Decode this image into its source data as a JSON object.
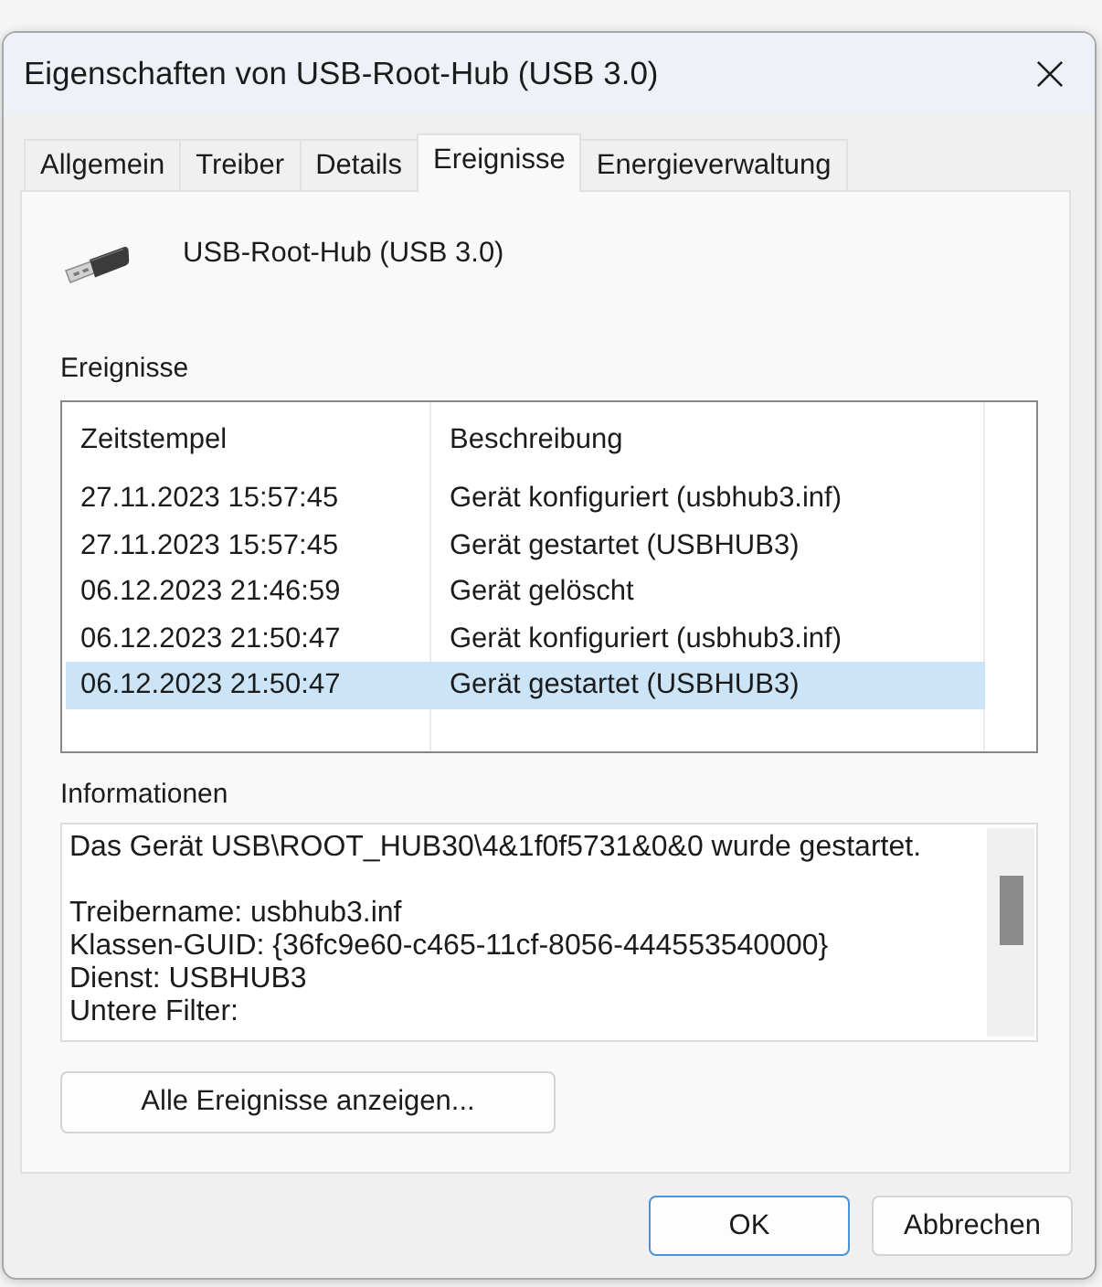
{
  "window": {
    "title": "Eigenschaften von USB-Root-Hub (USB 3.0)"
  },
  "tabs": [
    {
      "label": "Allgemein",
      "selected": false
    },
    {
      "label": "Treiber",
      "selected": false
    },
    {
      "label": "Details",
      "selected": false
    },
    {
      "label": "Ereignisse",
      "selected": true
    },
    {
      "label": "Energieverwaltung",
      "selected": false
    }
  ],
  "device": {
    "name": "USB-Root-Hub (USB 3.0)"
  },
  "events": {
    "label": "Ereignisse",
    "columns": [
      "Zeitstempel",
      "Beschreibung"
    ],
    "rows": [
      {
        "timestamp": "27.11.2023 15:57:45",
        "description": "Gerät konfiguriert (usbhub3.inf)",
        "selected": false
      },
      {
        "timestamp": "27.11.2023 15:57:45",
        "description": "Gerät gestartet (USBHUB3)",
        "selected": false
      },
      {
        "timestamp": "06.12.2023 21:46:59",
        "description": "Gerät gelöscht",
        "selected": false
      },
      {
        "timestamp": "06.12.2023 21:50:47",
        "description": "Gerät konfiguriert (usbhub3.inf)",
        "selected": false
      },
      {
        "timestamp": "06.12.2023 21:50:47",
        "description": "Gerät gestartet (USBHUB3)",
        "selected": true
      }
    ]
  },
  "information": {
    "label": "Informationen",
    "paragraphs": [
      [
        "Das Gerät USB\\ROOT_HUB30\\4&1f0f5731&0&0 wurde gestartet."
      ],
      [
        "Treibername: usbhub3.inf",
        "Klassen-GUID: {36fc9e60-c465-11cf-8056-444553540000}",
        "Dienst: USBHUB3",
        "Untere Filter:"
      ]
    ]
  },
  "show_all_button": {
    "label": "Alle Ereignisse anzeigen..."
  },
  "buttons": [
    {
      "label": "OK",
      "default": true
    },
    {
      "label": "Abbrechen",
      "default": false
    }
  ]
}
